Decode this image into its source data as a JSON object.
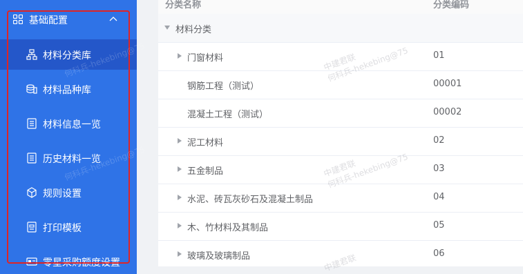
{
  "sidebar": {
    "group_label": "基础配置",
    "items": [
      {
        "label": "材料分类库",
        "icon": "hierarchy-icon"
      },
      {
        "label": "材料品种库",
        "icon": "stack-icon"
      },
      {
        "label": "材料信息一览",
        "icon": "document-list-icon"
      },
      {
        "label": "历史材料一览",
        "icon": "document-list-icon"
      },
      {
        "label": "规则设置",
        "icon": "cube-icon"
      },
      {
        "label": "打印模板",
        "icon": "template-icon"
      },
      {
        "label": "零星采购额度设置",
        "icon": "card-icon"
      }
    ]
  },
  "table": {
    "columns": [
      "分类名称",
      "分类编码"
    ],
    "rows": [
      {
        "name": "材料分类",
        "code": ""
      },
      {
        "name": "门窗材料",
        "code": "01"
      },
      {
        "name": "钢筋工程（测试）",
        "code": "00001"
      },
      {
        "name": "混凝土工程（测试）",
        "code": "00002"
      },
      {
        "name": "泥工材料",
        "code": "02"
      },
      {
        "name": "五金制品",
        "code": "03"
      },
      {
        "name": "水泥、砖瓦灰砂石及混凝土制品",
        "code": "04"
      },
      {
        "name": "木、竹材料及其制品",
        "code": "05"
      },
      {
        "name": "玻璃及玻璃制品",
        "code": "06"
      }
    ]
  },
  "watermark": {
    "line1": "中建君联",
    "line2": "何科兵-hekebing@75"
  },
  "colors": {
    "sidebar_bg": "#2f73e7",
    "sidebar_active": "#2457c9",
    "highlight_border": "#e02424"
  }
}
